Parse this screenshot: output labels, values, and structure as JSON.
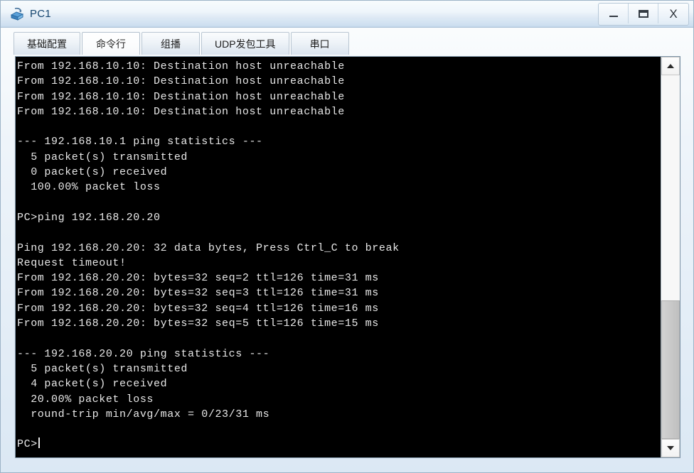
{
  "window": {
    "title": "PC1",
    "icon": "pc-device-icon",
    "controls": {
      "minimize_label": "_",
      "maximize_label": "□",
      "close_label": "X",
      "minimize_name": "minimize-button",
      "maximize_name": "maximize-button",
      "close_name": "close-button"
    }
  },
  "tabs": [
    {
      "label": "基础配置",
      "selected": false
    },
    {
      "label": "命令行",
      "selected": true
    },
    {
      "label": "组播",
      "selected": false
    },
    {
      "label": "UDP发包工具",
      "selected": false
    },
    {
      "label": "串口",
      "selected": false
    }
  ],
  "terminal": {
    "prompt": "PC>",
    "cursor_visible": true,
    "lines": [
      "From 192.168.10.10: Destination host unreachable",
      "From 192.168.10.10: Destination host unreachable",
      "From 192.168.10.10: Destination host unreachable",
      "From 192.168.10.10: Destination host unreachable",
      "",
      "--- 192.168.10.1 ping statistics ---",
      "  5 packet(s) transmitted",
      "  0 packet(s) received",
      "  100.00% packet loss",
      "",
      "PC>ping 192.168.20.20",
      "",
      "Ping 192.168.20.20: 32 data bytes, Press Ctrl_C to break",
      "Request timeout!",
      "From 192.168.20.20: bytes=32 seq=2 ttl=126 time=31 ms",
      "From 192.168.20.20: bytes=32 seq=3 ttl=126 time=31 ms",
      "From 192.168.20.20: bytes=32 seq=4 ttl=126 time=16 ms",
      "From 192.168.20.20: bytes=32 seq=5 ttl=126 time=15 ms",
      "",
      "--- 192.168.20.20 ping statistics ---",
      "  5 packet(s) transmitted",
      "  4 packet(s) received",
      "  20.00% packet loss",
      "  round-trip min/avg/max = 0/23/31 ms",
      ""
    ],
    "colors": {
      "background": "#000000",
      "foreground": "#e8e8e8"
    }
  },
  "scrollbar": {
    "up_arrow": "chevron-up-icon",
    "down_arrow": "chevron-down-icon",
    "thumb_top_pct": 62,
    "thumb_height_pct": 38
  }
}
